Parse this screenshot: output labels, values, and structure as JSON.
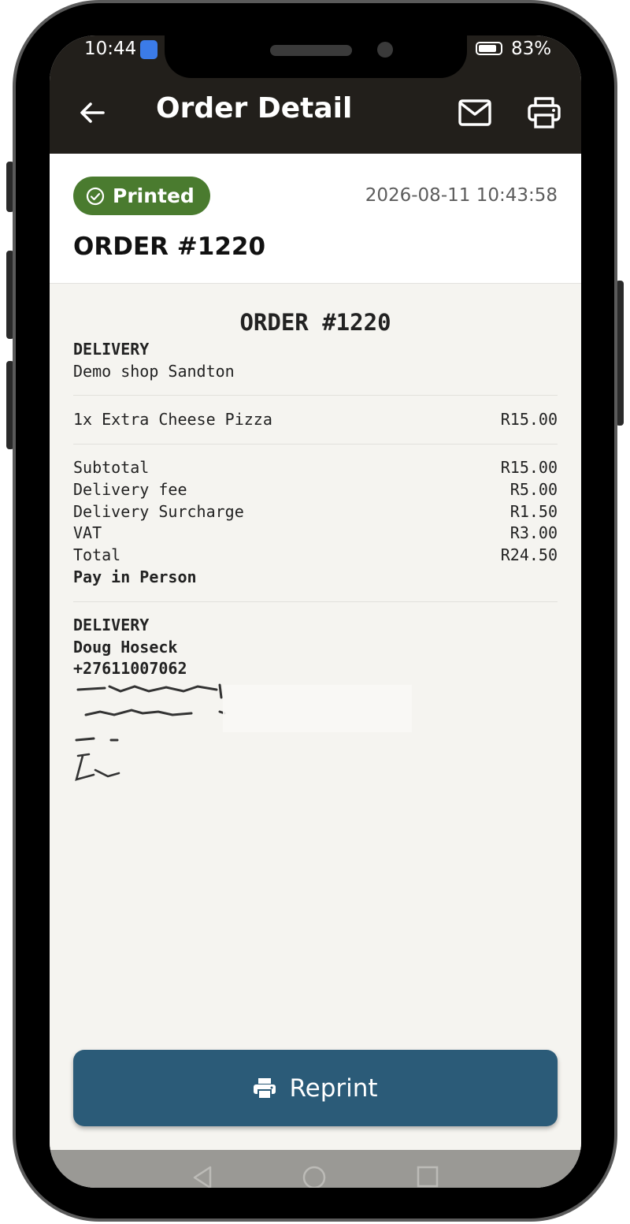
{
  "status_bar": {
    "time": "10:44",
    "battery": "83%",
    "battery_level": 0.83
  },
  "app_bar": {
    "title": "Order Detail",
    "back_icon": "arrow-left-icon",
    "mail_icon": "mail-icon",
    "print_icon": "printer-icon"
  },
  "header": {
    "status_badge": "Printed",
    "datetime": "2026-08-11 10:43:58",
    "order_title": "ORDER #1220"
  },
  "receipt": {
    "title": "ORDER #1220",
    "order_type": "DELIVERY",
    "shop": "Demo shop Sandton",
    "items": [
      {
        "label": "1x Extra Cheese Pizza",
        "amount": "R15.00"
      }
    ],
    "totals": [
      {
        "label": "Subtotal",
        "amount": "R15.00"
      },
      {
        "label": "Delivery fee",
        "amount": "R5.00"
      },
      {
        "label": "Delivery Surcharge",
        "amount": "R1.50"
      },
      {
        "label": "VAT",
        "amount": "R3.00"
      },
      {
        "label": "Total",
        "amount": "R24.50"
      }
    ],
    "payment": "Pay in Person",
    "customer": {
      "heading": "DELIVERY",
      "name": "Doug Hoseck",
      "phone": "+27611007062"
    }
  },
  "actions": {
    "reprint_label": "Reprint"
  },
  "colors": {
    "app_bar": "#221f1b",
    "badge": "#4a7b2f",
    "reprint_button": "#2b5b78",
    "receipt_bg": "#f5f4f0"
  }
}
